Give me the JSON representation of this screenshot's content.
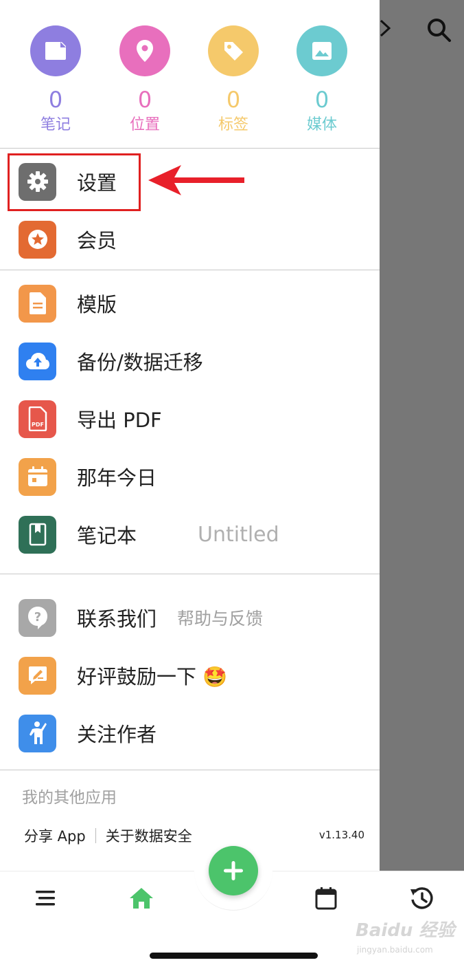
{
  "stats": [
    {
      "count": "0",
      "label": "笔记",
      "color": "#8e7ee0",
      "icon": "note-icon"
    },
    {
      "count": "0",
      "label": "位置",
      "color": "#e86fbd",
      "icon": "location-pin-icon"
    },
    {
      "count": "0",
      "label": "标签",
      "color": "#f5c96b",
      "icon": "tag-icon"
    },
    {
      "count": "0",
      "label": "媒体",
      "color": "#6ccbd0",
      "icon": "image-icon"
    }
  ],
  "menu": {
    "settings": "设置",
    "member": "会员",
    "template": "模版",
    "backup": "备份/数据迁移",
    "export_pdf": "导出 PDF",
    "on_this_day": "那年今日",
    "notebook": "笔记本",
    "notebook_value": "Untitled",
    "contact": "联系我们",
    "contact_sub": "帮助与反馈",
    "rate": "好评鼓励一下 🤩",
    "follow": "关注作者"
  },
  "footer": {
    "other_apps": "我的其他应用",
    "share_app": "分享 App",
    "data_security": "关于数据安全",
    "version": "v1.13.40"
  },
  "watermark": {
    "brand": "Baidu 经验",
    "url": "jingyan.baidu.com"
  },
  "colors": {
    "settings": "#6e6e6e",
    "member": "#e36a32",
    "template": "#f2974a",
    "backup": "#2f80f0",
    "export_pdf": "#e6574b",
    "on_this_day": "#f2a24a",
    "notebook": "#2f7057",
    "contact": "#a8a8a8",
    "rate": "#f2a24a",
    "follow": "#3f8eea",
    "fab": "#4cc46b"
  }
}
